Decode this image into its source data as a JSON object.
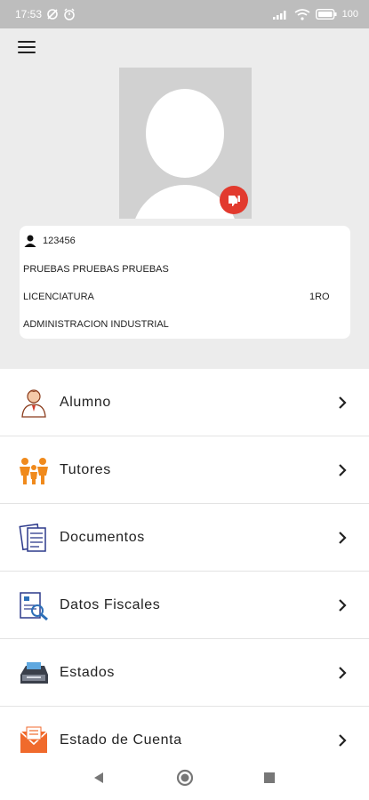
{
  "status_bar": {
    "time": "17:53",
    "battery": "100"
  },
  "profile": {
    "id": "123456",
    "name": "PRUEBAS PRUEBAS PRUEBAS",
    "level": "LICENCIATURA",
    "semester": "1RO",
    "program": "ADMINISTRACION INDUSTRIAL"
  },
  "menu": {
    "items": [
      {
        "label": "Alumno",
        "icon": "student-icon"
      },
      {
        "label": "Tutores",
        "icon": "tutors-icon"
      },
      {
        "label": "Documentos",
        "icon": "documents-icon"
      },
      {
        "label": "Datos Fiscales",
        "icon": "fiscal-data-icon"
      },
      {
        "label": "Estados",
        "icon": "states-icon"
      },
      {
        "label": "Estado de Cuenta",
        "icon": "account-statement-icon"
      }
    ]
  },
  "colors": {
    "status_bar": "#bdbdbd",
    "badge": "#e23a2e",
    "background": "#ececec"
  }
}
